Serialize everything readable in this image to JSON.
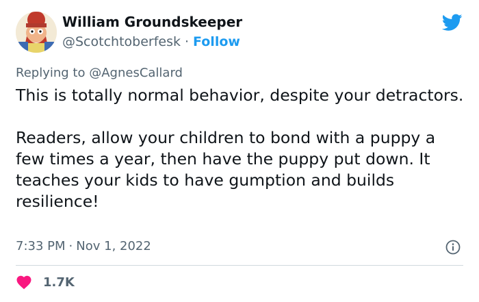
{
  "author": {
    "display_name": "William Groundskeeper",
    "handle": "@Scotchtoberfesk",
    "separator": "·",
    "follow_label": "Follow",
    "avatar_icon": "cartoon-groundskeeper-avatar"
  },
  "reply": {
    "prefix": "Replying to",
    "mention": "@AgnesCallard"
  },
  "tweet": {
    "paragraph_1": "This is totally normal behavior, despite your detractors.",
    "paragraph_2": "Readers, allow your children to bond with a puppy a few times a year, then have the puppy put down. It teaches your kids to have gumption and builds resilience!"
  },
  "meta": {
    "time": "7:33 PM",
    "separator": "·",
    "date": "Nov 1, 2022"
  },
  "engagement": {
    "like_count": "1.7K",
    "like_icon": "heart-icon"
  },
  "colors": {
    "brand_blue": "#1d9bf0",
    "like_red": "#f91880",
    "secondary_text": "#536471",
    "primary_text": "#0f1419",
    "divider": "#cfd9de"
  }
}
